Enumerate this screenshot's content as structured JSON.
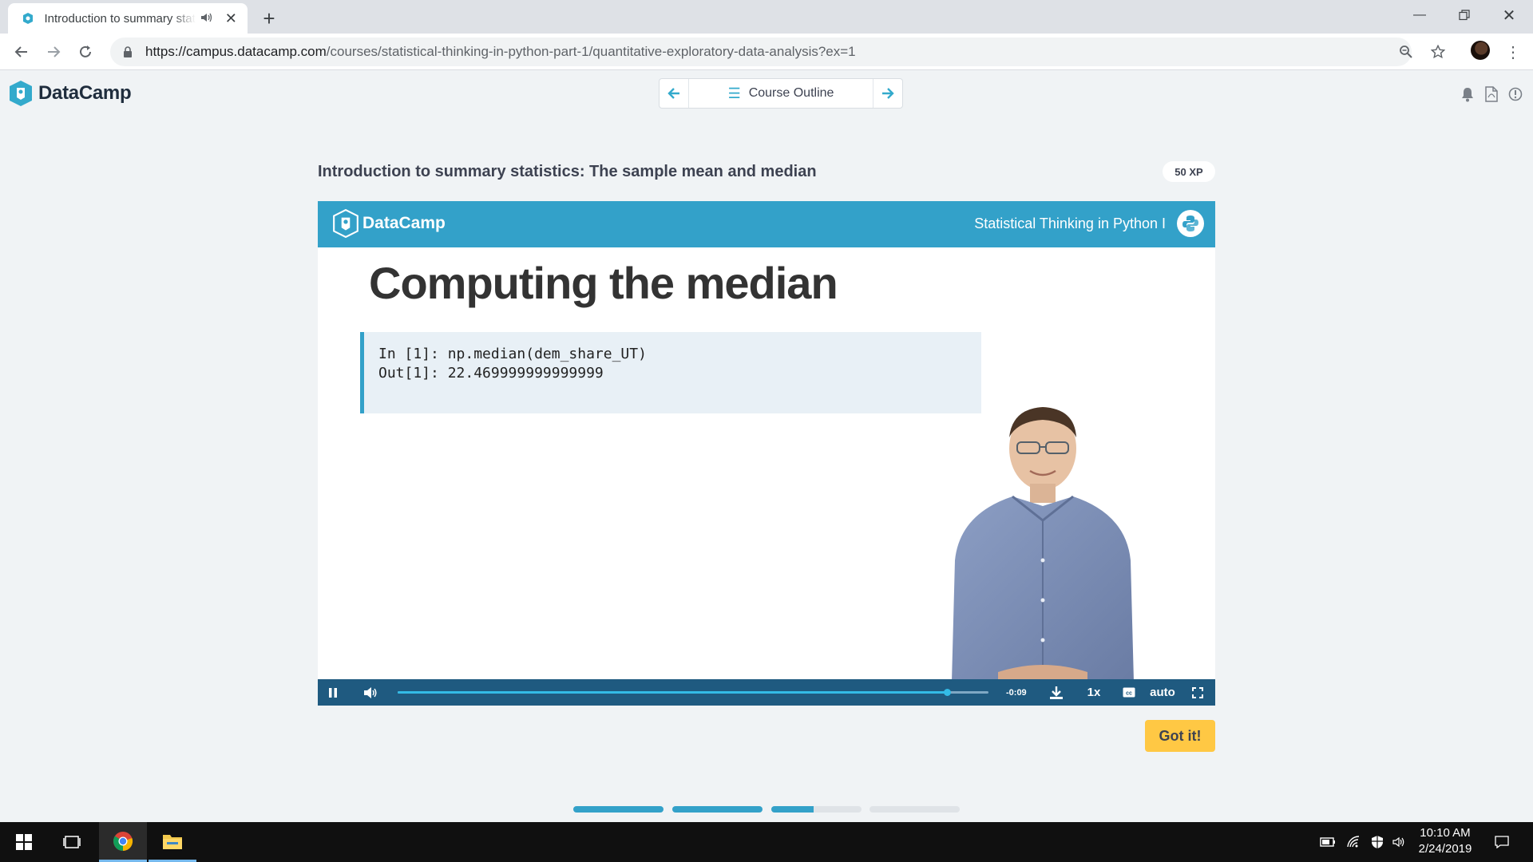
{
  "browser": {
    "tab_title": "Introduction to summary statistics: The sample mean and median",
    "url_host": "https://campus.datacamp.com",
    "url_path": "/courses/statistical-thinking-in-python-part-1/quantitative-exploratory-data-analysis?ex=1"
  },
  "header": {
    "brand": "DataCamp",
    "course_outline_label": "Course Outline"
  },
  "exercise": {
    "title": "Introduction to summary statistics: The sample mean and median",
    "xp": "50 XP",
    "got_it_label": "Got it!"
  },
  "slide": {
    "brand": "DataCamp",
    "course_name": "Statistical Thinking in Python I",
    "heading": "Computing the median",
    "code_line_1": "In [1]: np.median(dem_share_UT)",
    "code_line_2": "Out[1]: 22.469999999999999"
  },
  "player": {
    "time_remaining": "-0:09",
    "speed": "1x",
    "quality": "auto",
    "progress_fraction": 0.93
  },
  "progress_steps": [
    1,
    1,
    0.47,
    0
  ],
  "taskbar": {
    "time": "10:10 AM",
    "date": "2/24/2019"
  },
  "colors": {
    "accent": "#33a1c9",
    "button": "#ffc844",
    "player_bar": "#1f5a80"
  }
}
